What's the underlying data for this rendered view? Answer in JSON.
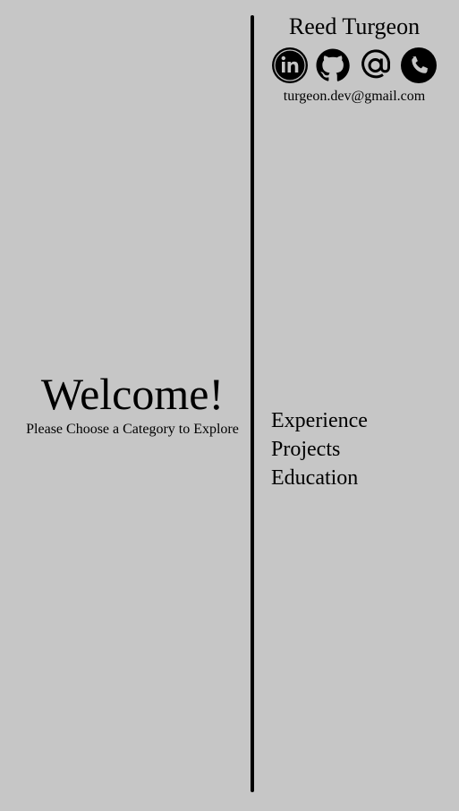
{
  "welcome": {
    "title": "Welcome!",
    "subtitle": "Please Choose a Category to Explore"
  },
  "header": {
    "name": "Reed Turgeon",
    "email": "turgeon.dev@gmail.com",
    "icons": [
      "linkedin-icon",
      "github-icon",
      "at-sign-icon",
      "phone-icon"
    ]
  },
  "nav": {
    "items": [
      {
        "label": "Experience"
      },
      {
        "label": "Projects"
      },
      {
        "label": "Education"
      }
    ]
  },
  "colors": {
    "background": "#c6c6c6",
    "foreground": "#000000"
  }
}
